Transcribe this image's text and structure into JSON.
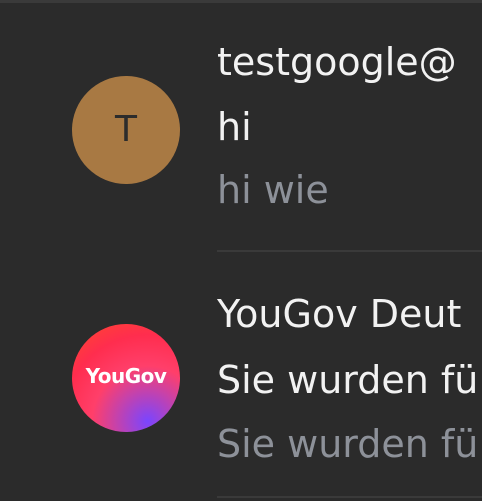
{
  "colors": {
    "background": "#2b2b2b",
    "primary_text": "#f2f2f2",
    "secondary_text": "#8d9199",
    "avatar_t": "#a87943"
  },
  "messages": [
    {
      "sender": "testgoogle@",
      "subject": "hi",
      "preview": "hi wie",
      "avatar": {
        "type": "letter",
        "text": "T"
      }
    },
    {
      "sender": "YouGov Deut",
      "subject": "Sie wurden fü",
      "preview": "Sie wurden fü",
      "avatar": {
        "type": "logo",
        "text": "YouGov"
      }
    }
  ]
}
